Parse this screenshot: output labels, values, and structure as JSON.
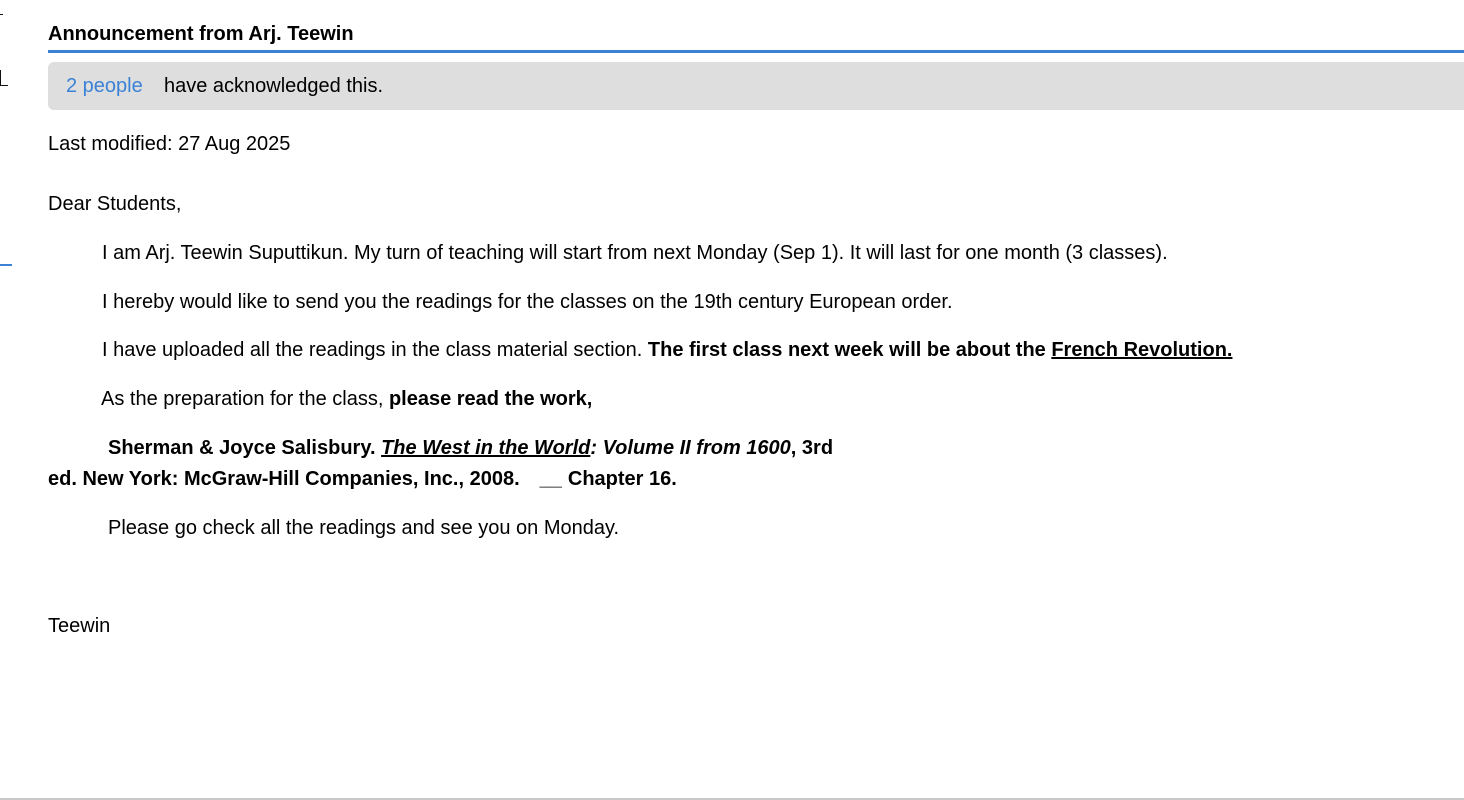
{
  "announcement": {
    "title": "Announcement from Arj. Teewin",
    "acknowledged": {
      "count_link": "2 people",
      "text": "have acknowledged this."
    },
    "last_modified": "Last modified: 27 Aug 2025",
    "body": {
      "greeting": "Dear Students,",
      "p1": "I am Arj. Teewin Suputtikun. My turn of teaching will start from next Monday (Sep 1). It will last for one month (3 classes).",
      "p2": "I hereby would like to send you the readings for the classes on the 19th century European order.",
      "p3_plain": "I have uploaded all the readings in the class material section. ",
      "p3_bold": "The first class next week will be about the ",
      "p3_topic": "French Revolution.",
      "p4_plain": "As the preparation for the class, ",
      "p4_bold": "please read the work,",
      "citation_authors": "Sherman & Joyce Salisbury. ",
      "citation_book": "The West in the World",
      "citation_volume": ": Volume II from 1600",
      "citation_edition": ", 3rd",
      "citation_line2": "ed. New York: McGraw-Hill Companies, Inc., 2008.",
      "citation_blank": "__",
      "citation_chapter": "Chapter 16.",
      "closing": "Please go check all the readings and see you on Monday.",
      "signature": "Teewin"
    }
  }
}
